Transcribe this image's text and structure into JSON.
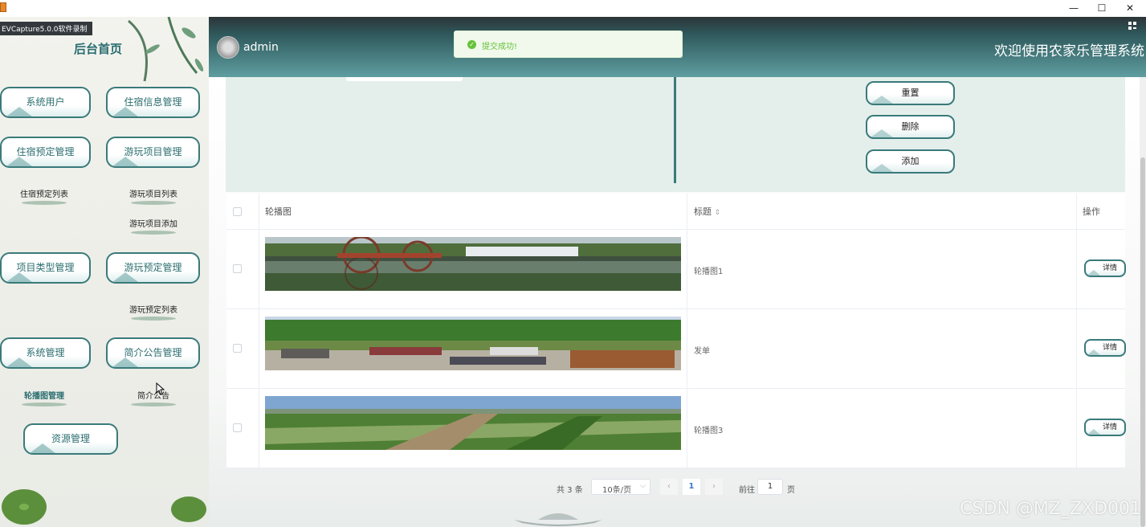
{
  "window": {
    "recorder_label": "EVCapture5.0.0软件录制",
    "minimize_icon": "—",
    "maximize_icon": "☐",
    "close_icon": "✕"
  },
  "sidebar": {
    "home_title": "后台首页",
    "menus": [
      {
        "label": "系统用户"
      },
      {
        "label": "住宿信息管理"
      },
      {
        "label": "住宿预定管理"
      },
      {
        "label": "游玩项目管理"
      },
      {
        "label": "项目类型管理"
      },
      {
        "label": "游玩预定管理"
      },
      {
        "label": "系统管理"
      },
      {
        "label": "简介公告管理"
      },
      {
        "label": "资源管理"
      }
    ],
    "sub_items": {
      "booking_list": "住宿预定列表",
      "project_list": "游玩项目列表",
      "project_add": "游玩项目添加",
      "play_booking_list": "游玩预定列表",
      "carousel_manage": "轮播图管理",
      "intro_notice": "简介公告"
    }
  },
  "header": {
    "username": "admin",
    "welcome": "欢迎使用农家乐管理系统"
  },
  "toast": {
    "message": "提交成功!",
    "type": "success"
  },
  "actions": {
    "reset": "重置",
    "delete": "删除",
    "add": "添加"
  },
  "table": {
    "columns": {
      "image": "轮播图",
      "title": "标题",
      "sort_icon": "⇕",
      "actions": "操作"
    },
    "rows": [
      {
        "title": "轮播图1",
        "detail": "详情",
        "thumbnail": "waterwheel-lake"
      },
      {
        "title": "发单",
        "detail": "详情",
        "thumbnail": "mountain-market"
      },
      {
        "title": "轮播图3",
        "detail": "详情",
        "thumbnail": "farm-fields"
      }
    ]
  },
  "pagination": {
    "total": "共 3 条",
    "page_size": "10条/页",
    "current_page": "1",
    "goto_label": "前往",
    "goto_value": "1",
    "page_suffix": "页"
  },
  "watermark": "CSDN @MZ_ZXD001",
  "colors": {
    "accent": "#3a7a7a",
    "header_top": "#2c3538",
    "header_bottom": "#5f9ea1",
    "success": "#67c23a"
  }
}
